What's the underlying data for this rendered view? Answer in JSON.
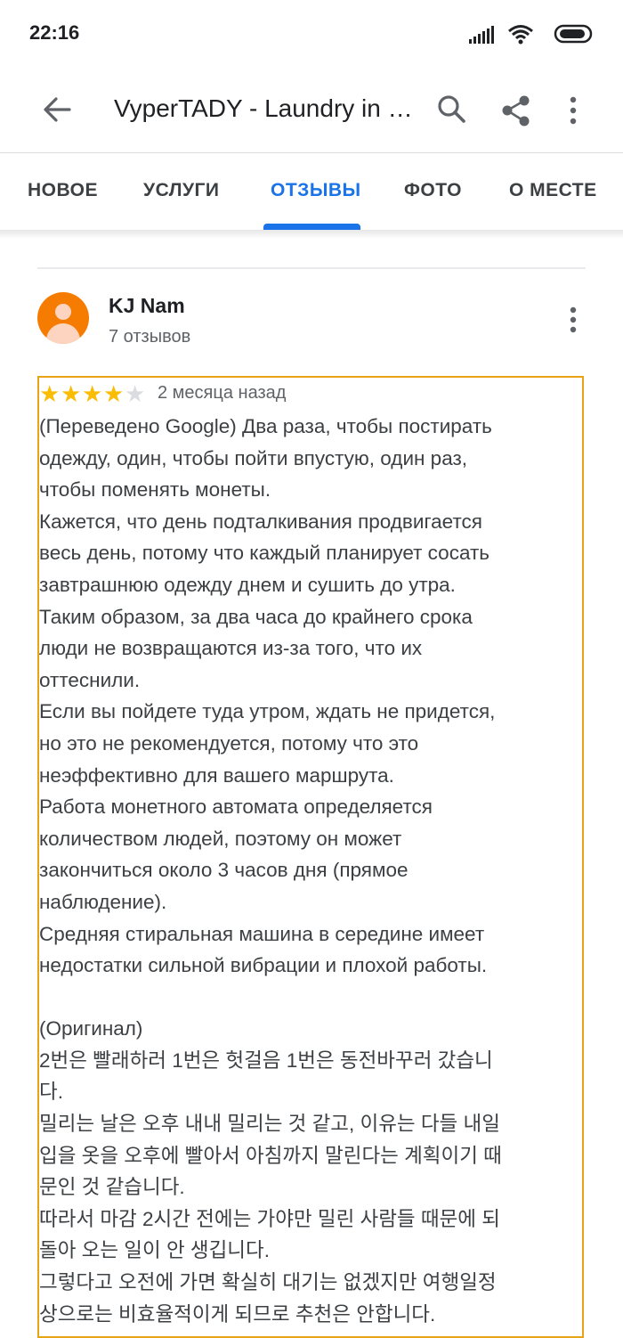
{
  "status_bar": {
    "time": "22:16",
    "icons": [
      "signal-icon",
      "wifi-icon",
      "battery-icon"
    ]
  },
  "app_bar": {
    "title": "VyperTADY - Laundry in P...",
    "icons": [
      "back-arrow-icon",
      "search-icon",
      "share-icon",
      "more-vert-icon"
    ]
  },
  "tabs": [
    {
      "label": "НОВОЕ",
      "active": false
    },
    {
      "label": "УСЛУГИ",
      "active": false
    },
    {
      "label": "ОТЗЫВЫ",
      "active": true
    },
    {
      "label": "ФОТО",
      "active": false
    },
    {
      "label": "О МЕСТЕ",
      "active": false
    }
  ],
  "colors": {
    "accent": "#1a73e8",
    "star": "#fbbc04",
    "avatar": "#f57c00",
    "highlight_border": "#e8a317"
  },
  "review": {
    "author": "KJ Nam",
    "author_reviews": "7 отзывов",
    "rating": 4,
    "rating_max": 5,
    "date": "2 месяца назад",
    "lines": [
      "(Переведено Google) Два раза, чтобы постирать",
      "одежду, один, чтобы пойти впустую, один раз,",
      "чтобы поменять монеты.",
      "Кажется, что день подталкивания продвигается",
      "весь день, потому что каждый планирует сосать",
      "завтрашнюю одежду днем и сушить до утра.",
      "Таким образом, за два часа до крайнего срока",
      "люди не возвращаются из-за того, что их",
      "оттеснили.",
      "Если вы пойдете туда утром, ждать не придется,",
      "но это не рекомендуется, потому что это",
      "неэффективно для вашего маршрута.",
      "Работа монетного автомата определяется",
      "количеством людей, поэтому он может",
      "закончиться около 3 часов дня (прямое",
      "наблюдение).",
      "Средняя стиральная машина в середине имеет",
      "недостатки сильной вибрации и плохой работы.",
      "",
      "(Оригинал)",
      "2번은 빨래하러 1번은 헛걸음 1번은 동전바꾸러 갔습니",
      "다.",
      "밀리는 날은 오후 내내 밀리는 것 같고, 이유는 다들 내일",
      "입을 옷을 오후에 빨아서 아침까지 말린다는 계획이기 때",
      "문인 것 같습니다.",
      "따라서 마감 2시간 전에는 가야만 밀린 사람들 때문에 되",
      "돌아 오는 일이 안 생깁니다.",
      "그렇다고 오전에 가면 확실히 대기는 없겠지만 여행일정",
      "상으로는 비효율적이게 되므로 추천은 안합니다."
    ]
  }
}
